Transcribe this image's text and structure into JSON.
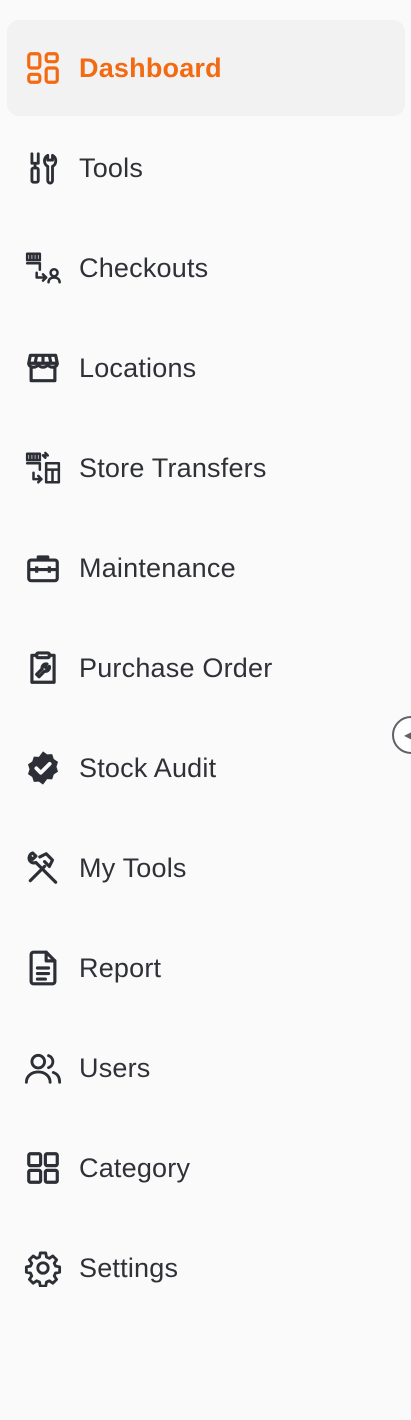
{
  "sidebar": {
    "accent_color": "#f26a12",
    "items": [
      {
        "label": "Dashboard",
        "icon": "dashboard-icon",
        "active": true
      },
      {
        "label": "Tools",
        "icon": "tools-icon",
        "active": false
      },
      {
        "label": "Checkouts",
        "icon": "checkouts-icon",
        "active": false
      },
      {
        "label": "Locations",
        "icon": "store-icon",
        "active": false
      },
      {
        "label": "Store Transfers",
        "icon": "store-transfer-icon",
        "active": false
      },
      {
        "label": "Maintenance",
        "icon": "toolbox-icon",
        "active": false
      },
      {
        "label": "Purchase Order",
        "icon": "clipboard-wrench-icon",
        "active": false
      },
      {
        "label": "Stock Audit",
        "icon": "verified-badge-icon",
        "active": false
      },
      {
        "label": "My Tools",
        "icon": "hammer-wrench-icon",
        "active": false
      },
      {
        "label": "Report",
        "icon": "document-icon",
        "active": false
      },
      {
        "label": "Users",
        "icon": "users-icon",
        "active": false
      },
      {
        "label": "Category",
        "icon": "grid-icon",
        "active": false
      },
      {
        "label": "Settings",
        "icon": "gear-icon",
        "active": false
      }
    ],
    "collapse_handle_icon": "chevron-left-icon"
  }
}
